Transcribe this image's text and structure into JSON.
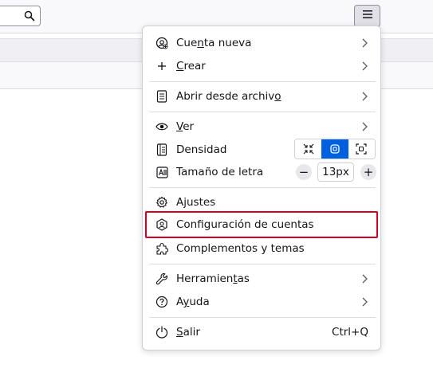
{
  "search": {
    "value": "",
    "icon": "search-icon"
  },
  "menu_button": {
    "icon": "hamburger-menu-icon"
  },
  "app_menu": {
    "new_account": {
      "label_pre": "Cue",
      "label_key": "n",
      "label_post": "ta nueva",
      "icon": "new-account-icon"
    },
    "create": {
      "label_pre": "",
      "label_key": "C",
      "label_post": "rear",
      "icon": "plus-icon"
    },
    "open_file": {
      "label_pre": "Abrir desde archiv",
      "label_key": "o",
      "label_post": "",
      "icon": "file-icon"
    },
    "view": {
      "label_pre": "",
      "label_key": "V",
      "label_post": "er",
      "icon": "eye-icon"
    },
    "density": {
      "label": "Densidad",
      "icon": "density-icon",
      "options": [
        "compact",
        "normal",
        "touch"
      ],
      "selected": "normal"
    },
    "font_size": {
      "label": "Tamaño de letra",
      "icon": "font-size-icon",
      "value": "13px",
      "minus": "−",
      "plus": "+"
    },
    "settings": {
      "label": "Ajustes",
      "icon": "gear-icon"
    },
    "account_settings": {
      "label": "Configuración de cuentas",
      "icon": "account-settings-icon"
    },
    "addons": {
      "label": "Complementos y temas",
      "icon": "puzzle-icon"
    },
    "tools": {
      "label_pre": "Herramien",
      "label_key": "t",
      "label_post": "as",
      "icon": "wrench-icon"
    },
    "help": {
      "label_pre": "A",
      "label_key": "y",
      "label_post": "uda",
      "icon": "help-icon"
    },
    "quit": {
      "label_pre": "",
      "label_key": "S",
      "label_post": "alir",
      "shortcut": "Ctrl+Q",
      "icon": "power-icon"
    }
  },
  "colors": {
    "accent": "#0061e0",
    "highlight_border": "#d70022"
  }
}
